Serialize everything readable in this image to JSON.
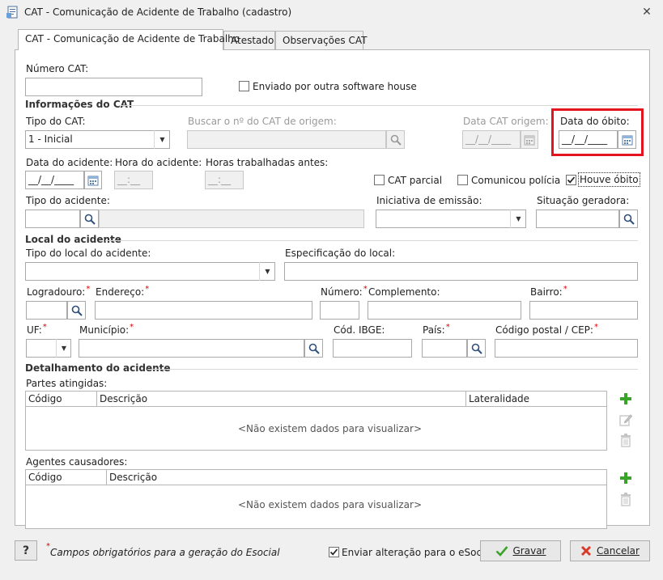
{
  "window": {
    "title": "CAT - Comunicação de Acidente de Trabalho (cadastro)"
  },
  "tabs": [
    {
      "label": "CAT - Comunicação de Acidente de Trabalho"
    },
    {
      "label": "Atestado"
    },
    {
      "label": "Observações CAT"
    }
  ],
  "form": {
    "numero_cat_label": "Número CAT:",
    "numero_cat_value": "",
    "enviado_label": "Enviado por outra software house",
    "sec_info": "Informações do CAT",
    "tipo_cat_label": "Tipo do CAT:",
    "tipo_cat_value": "1 - Inicial",
    "buscar_label": "Buscar o nº do CAT de origem:",
    "data_cat_origem_label": "Data CAT origem:",
    "data_cat_origem_value": "__/__/____",
    "data_obito_label": "Data do óbito:",
    "data_obito_value": "__/__/____",
    "data_acidente_label": "Data do acidente:",
    "data_acidente_value": "__/__/____",
    "hora_acidente_label": "Hora do acidente:",
    "hora_acidente_value": "__:__",
    "horas_trab_label": "Horas trabalhadas antes:",
    "horas_trab_value": "__:__",
    "cat_parcial_label": "CAT parcial",
    "comunicou_label": "Comunicou polícia",
    "houve_obito_label": "Houve óbito",
    "houve_obito_checked": true,
    "tipo_acidente_label": "Tipo do acidente:",
    "iniciativa_label": "Iniciativa de emissão:",
    "situacao_label": "Situação geradora:",
    "sec_local": "Local do acidente",
    "tipo_local_label": "Tipo do local do acidente:",
    "especificacao_label": "Especificação do local:",
    "logradouro_label": "Logradouro:",
    "endereco_label": "Endereço:",
    "numero_label": "Número:",
    "complemento_label": "Complemento:",
    "bairro_label": "Bairro:",
    "uf_label": "UF:",
    "municipio_label": "Município:",
    "cod_ibge_label": "Cód. IBGE:",
    "pais_label": "País:",
    "cep_label": "Código postal / CEP:",
    "sec_detalhamento": "Detalhamento do acidente",
    "partes_label": "Partes atingidas:",
    "partes_columns": [
      "Código",
      "Descrição",
      "Lateralidade"
    ],
    "partes_empty": "<Não existem dados para visualizar>",
    "agentes_label": "Agentes causadores:",
    "agentes_columns": [
      "Código",
      "Descrição"
    ],
    "agentes_empty": "<Não existem dados para visualizar>",
    "required_mark": "*"
  },
  "footer": {
    "help_label": "?",
    "required_note": "Campos obrigatórios para a geração do Esocial",
    "required_mark": "*",
    "enviar_label": "Enviar alteração para o eSocial",
    "enviar_checked": true,
    "gravar_label": "Gravar",
    "cancelar_label": "Cancelar"
  },
  "colors": {
    "highlight": "#e3141e",
    "add_green": "#3aa32a",
    "cancel_red": "#d83a2a"
  }
}
